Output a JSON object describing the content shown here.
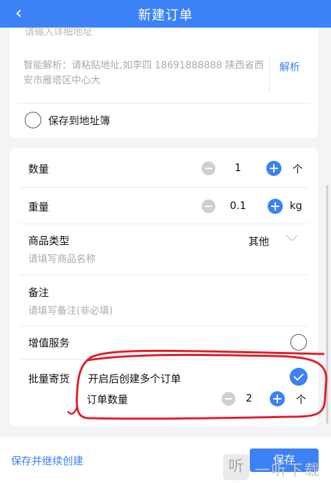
{
  "header": {
    "back_icon": "‹",
    "title": "新建订单"
  },
  "address": {
    "cut_text": "请输入详细地址",
    "parse_placeholder": "智能解析：请粘贴地址,如李四 18691888888 陕西省西安市雁塔区中心大",
    "parse_button": "解析",
    "save_to_book": "保存到地址簿"
  },
  "form": {
    "quantity": {
      "label": "数量",
      "value": "1",
      "unit": "个"
    },
    "weight": {
      "label": "重量",
      "value": "0.1",
      "unit": "kg"
    },
    "category": {
      "label": "商品类型",
      "value": "其他",
      "placeholder": "请填写商品名称"
    },
    "remark": {
      "label": "备注",
      "placeholder": "请填写备注(非必填)"
    },
    "value_added": {
      "label": "增值服务"
    },
    "bulk": {
      "label": "批量寄货",
      "hint": "开启后创建多个订单",
      "count_label": "订单数量",
      "count_value": "2",
      "count_unit": "个"
    }
  },
  "footer": {
    "continue_label": "保存并继续创建",
    "save_label": "保存"
  },
  "watermark": {
    "text": "一听下载",
    "logo": "听"
  },
  "colors": {
    "accent": "#3b82f6",
    "annotation": "#e11d2a"
  }
}
